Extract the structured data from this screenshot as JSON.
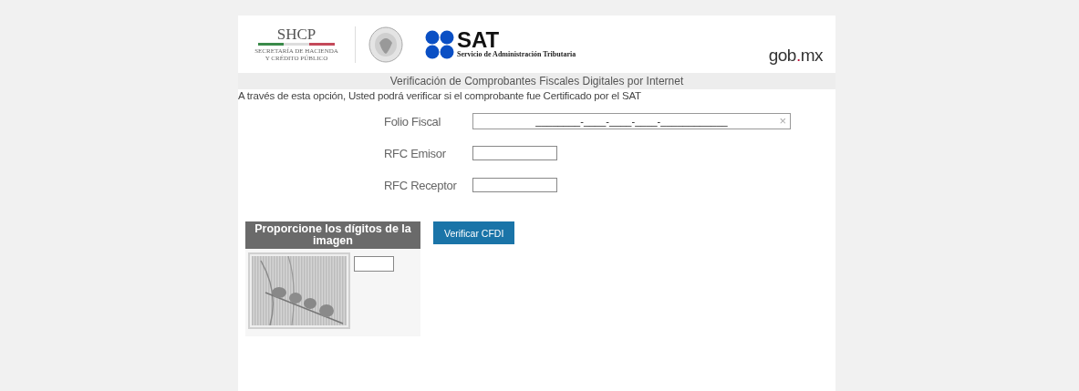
{
  "header": {
    "shcp": {
      "acronym": "SHCP",
      "line_1": "SECRETARÍA DE HACIENDA",
      "line_2": "Y CRÉDITO PÚBLICO"
    },
    "sat": {
      "acronym": "SAT",
      "subtitle": "Servicio de Administración Tributaria"
    },
    "gob": {
      "name": "gob",
      "dot": ".",
      "tld": "mx"
    }
  },
  "title_bar": "Verificación de Comprobantes Fiscales Digitales por Internet",
  "intro": "A través de esta opción, Usted podrá verificar si el comprobante fue Certificado por el SAT",
  "fields": [
    {
      "label": "Folio Fiscal",
      "value": "________-____-____-____-____________",
      "kind": "wide",
      "clear": "×"
    },
    {
      "label": "RFC Emisor",
      "kind": "short"
    },
    {
      "label": "RFC Receptor",
      "kind": "short"
    }
  ],
  "captcha": {
    "title": "Proporcione los dígitos de la imagen"
  },
  "verify_button": "Verificar CFDI"
}
